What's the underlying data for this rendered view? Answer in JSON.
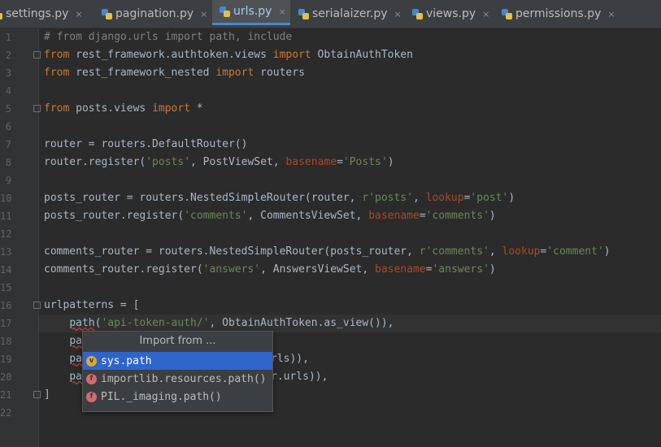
{
  "tabs": [
    {
      "label": "settings.py",
      "close": "×",
      "active": false
    },
    {
      "label": "pagination.py",
      "close": "×",
      "active": false
    },
    {
      "label": "urls.py",
      "close": "×",
      "active": true
    },
    {
      "label": "serialaizer.py",
      "close": "×",
      "active": false
    },
    {
      "label": "views.py",
      "close": "×",
      "active": false
    },
    {
      "label": "permissions.py",
      "close": "×",
      "active": false
    }
  ],
  "gutter": {
    "line_numbers": [
      "1",
      "2",
      "3",
      "4",
      "5",
      "6",
      "7",
      "8",
      "9",
      "10",
      "11",
      "12",
      "13",
      "14",
      "15",
      "16",
      "17",
      "18",
      "19",
      "20",
      "21",
      "22"
    ]
  },
  "code": {
    "line1": "# from django.urls import path, include",
    "line2": {
      "kw1": "from",
      "mod": " rest_framework.authtoken.views ",
      "kw2": "import",
      "name": " ObtainAuthToken"
    },
    "line3": {
      "kw1": "from",
      "mod": " rest_framework_nested ",
      "kw2": "import",
      "name": " routers"
    },
    "line5": {
      "kw1": "from",
      "mod": " posts.views ",
      "kw2": "import",
      "name": " *"
    },
    "line7": "router = routers.DefaultRouter()",
    "line8": {
      "a": "router.register(",
      "s1": "'posts'",
      "b": ", PostViewSet, ",
      "kw": "basename",
      "eq": "=",
      "s2": "'Posts'",
      "c": ")"
    },
    "line10": {
      "a": "posts_router = routers.NestedSimpleRouter(router, ",
      "s1": "r'posts'",
      "b": ", ",
      "kw": "lookup",
      "eq": "=",
      "s2": "'post'",
      "c": ")"
    },
    "line11": {
      "a": "posts_router.register(",
      "s1": "'comments'",
      "b": ", CommentsViewSet, ",
      "kw": "basename",
      "eq": "=",
      "s2": "'comments'",
      "c": ")"
    },
    "line13": {
      "a": "comments_router = routers.NestedSimpleRouter(posts_router, ",
      "s1": "r'comments'",
      "b": ", ",
      "kw": "lookup",
      "eq": "=",
      "s2": "'comment'",
      "c": ")"
    },
    "line14": {
      "a": "comments_router.register(",
      "s1": "'answers'",
      "b": ", AnswersViewSet, ",
      "kw": "basename",
      "eq": "=",
      "s2": "'answers'",
      "c": ")"
    },
    "line16": "urlpatterns = [",
    "line17": {
      "indent": "    ",
      "fn": "path",
      "a": "(",
      "s1": "'api-token-auth/'",
      "b": ", ObtainAuthToken.as_view()),"
    },
    "line18": {
      "indent": "    ",
      "fn": "pa"
    },
    "line19": {
      "indent": "    ",
      "fn": "pa",
      "tail": "rls)),"
    },
    "line20": {
      "indent": "    ",
      "fn": "pa",
      "tail": "r.urls)),"
    },
    "line21": "]"
  },
  "popup": {
    "title": "Import from ...",
    "items": [
      {
        "badge": "v",
        "label": "sys.path",
        "selected": true
      },
      {
        "badge": "f",
        "label": "importlib.resources.path()",
        "selected": false
      },
      {
        "badge": "f",
        "label": "PIL._imaging.path()",
        "selected": false
      }
    ]
  },
  "colors": {
    "background": "#2b2b2b",
    "keyword": "#cc7832",
    "string": "#6a8759",
    "comment": "#808080",
    "kwarg": "#aa4926",
    "text": "#a9b7c6",
    "selection": "#2f65ca"
  }
}
